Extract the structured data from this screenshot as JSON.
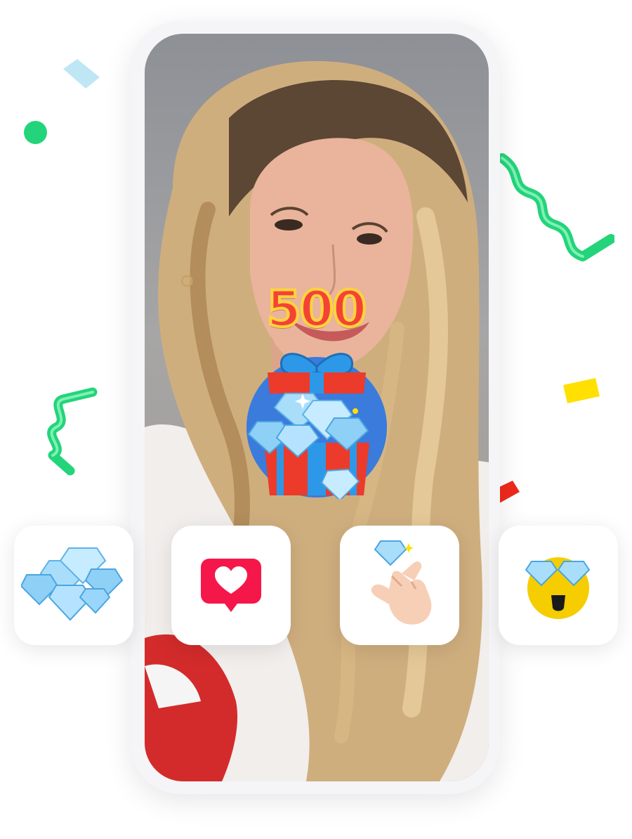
{
  "gift": {
    "count": "500"
  },
  "icons": {
    "gift_box": "diamond-gift-box-icon",
    "diamonds": "diamonds-icon",
    "like": "heart-message-icon",
    "finger_heart": "finger-heart-diamond-icon",
    "star_eyes": "diamond-eyes-emoji-icon"
  },
  "colors": {
    "gift_number": "#f44336",
    "gift_number_outline": "#ffd43b",
    "heart_badge": "#f5174a",
    "emoji": "#f5cd00",
    "diamond": "#8fd0f7",
    "confetti_green": "#23d47a",
    "confetti_red": "#ee2a1c",
    "confetti_yellow": "#ffe000"
  }
}
